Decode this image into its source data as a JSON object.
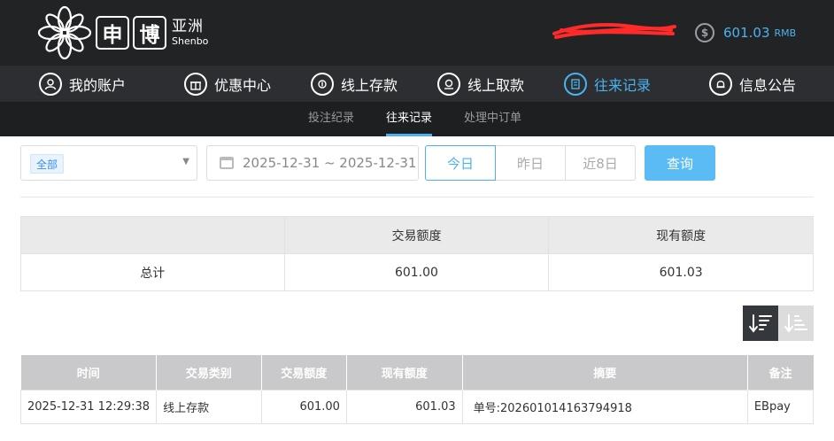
{
  "brand": {
    "char1": "申",
    "char2": "博",
    "name_cn": "亚洲",
    "name_en": "Shenbo"
  },
  "account": {
    "balance_symbol": "$",
    "balance": "601.03",
    "currency": "RMB"
  },
  "nav": {
    "items": [
      {
        "label": "我的账户",
        "icon": "user-icon"
      },
      {
        "label": "优惠中心",
        "icon": "gift-icon"
      },
      {
        "label": "线上存款",
        "icon": "deposit-icon"
      },
      {
        "label": "线上取款",
        "icon": "withdraw-icon"
      },
      {
        "label": "往来记录",
        "icon": "record-icon",
        "active": true
      },
      {
        "label": "信息公告",
        "icon": "bell-icon"
      }
    ]
  },
  "subtabs": [
    {
      "label": "投注纪录"
    },
    {
      "label": "往来记录",
      "active": true
    },
    {
      "label": "处理中订单"
    }
  ],
  "filters": {
    "type_selected": "全部",
    "date_range": "2025-12-31 ~ 2025-12-31",
    "quick": [
      "今日",
      "昨日",
      "近8日"
    ],
    "quick_active": "今日",
    "query_label": "查询"
  },
  "summary": {
    "headers": [
      "",
      "交易额度",
      "现有额度"
    ],
    "row": [
      "总计",
      "601.00",
      "601.03"
    ]
  },
  "detail": {
    "headers": [
      "时间",
      "交易类别",
      "交易额度",
      "现有额度",
      "摘要",
      "备注"
    ],
    "rows": [
      [
        "2025-12-31 12:29:38",
        "线上存款",
        "601.00",
        "601.03",
        "单号:202601014163794918",
        "EBpay"
      ]
    ]
  },
  "colors": {
    "accent": "#4ab3ee",
    "header_bg": "#222325",
    "nav_bg": "#2d2e31",
    "redaction": "#ff2a2a"
  }
}
